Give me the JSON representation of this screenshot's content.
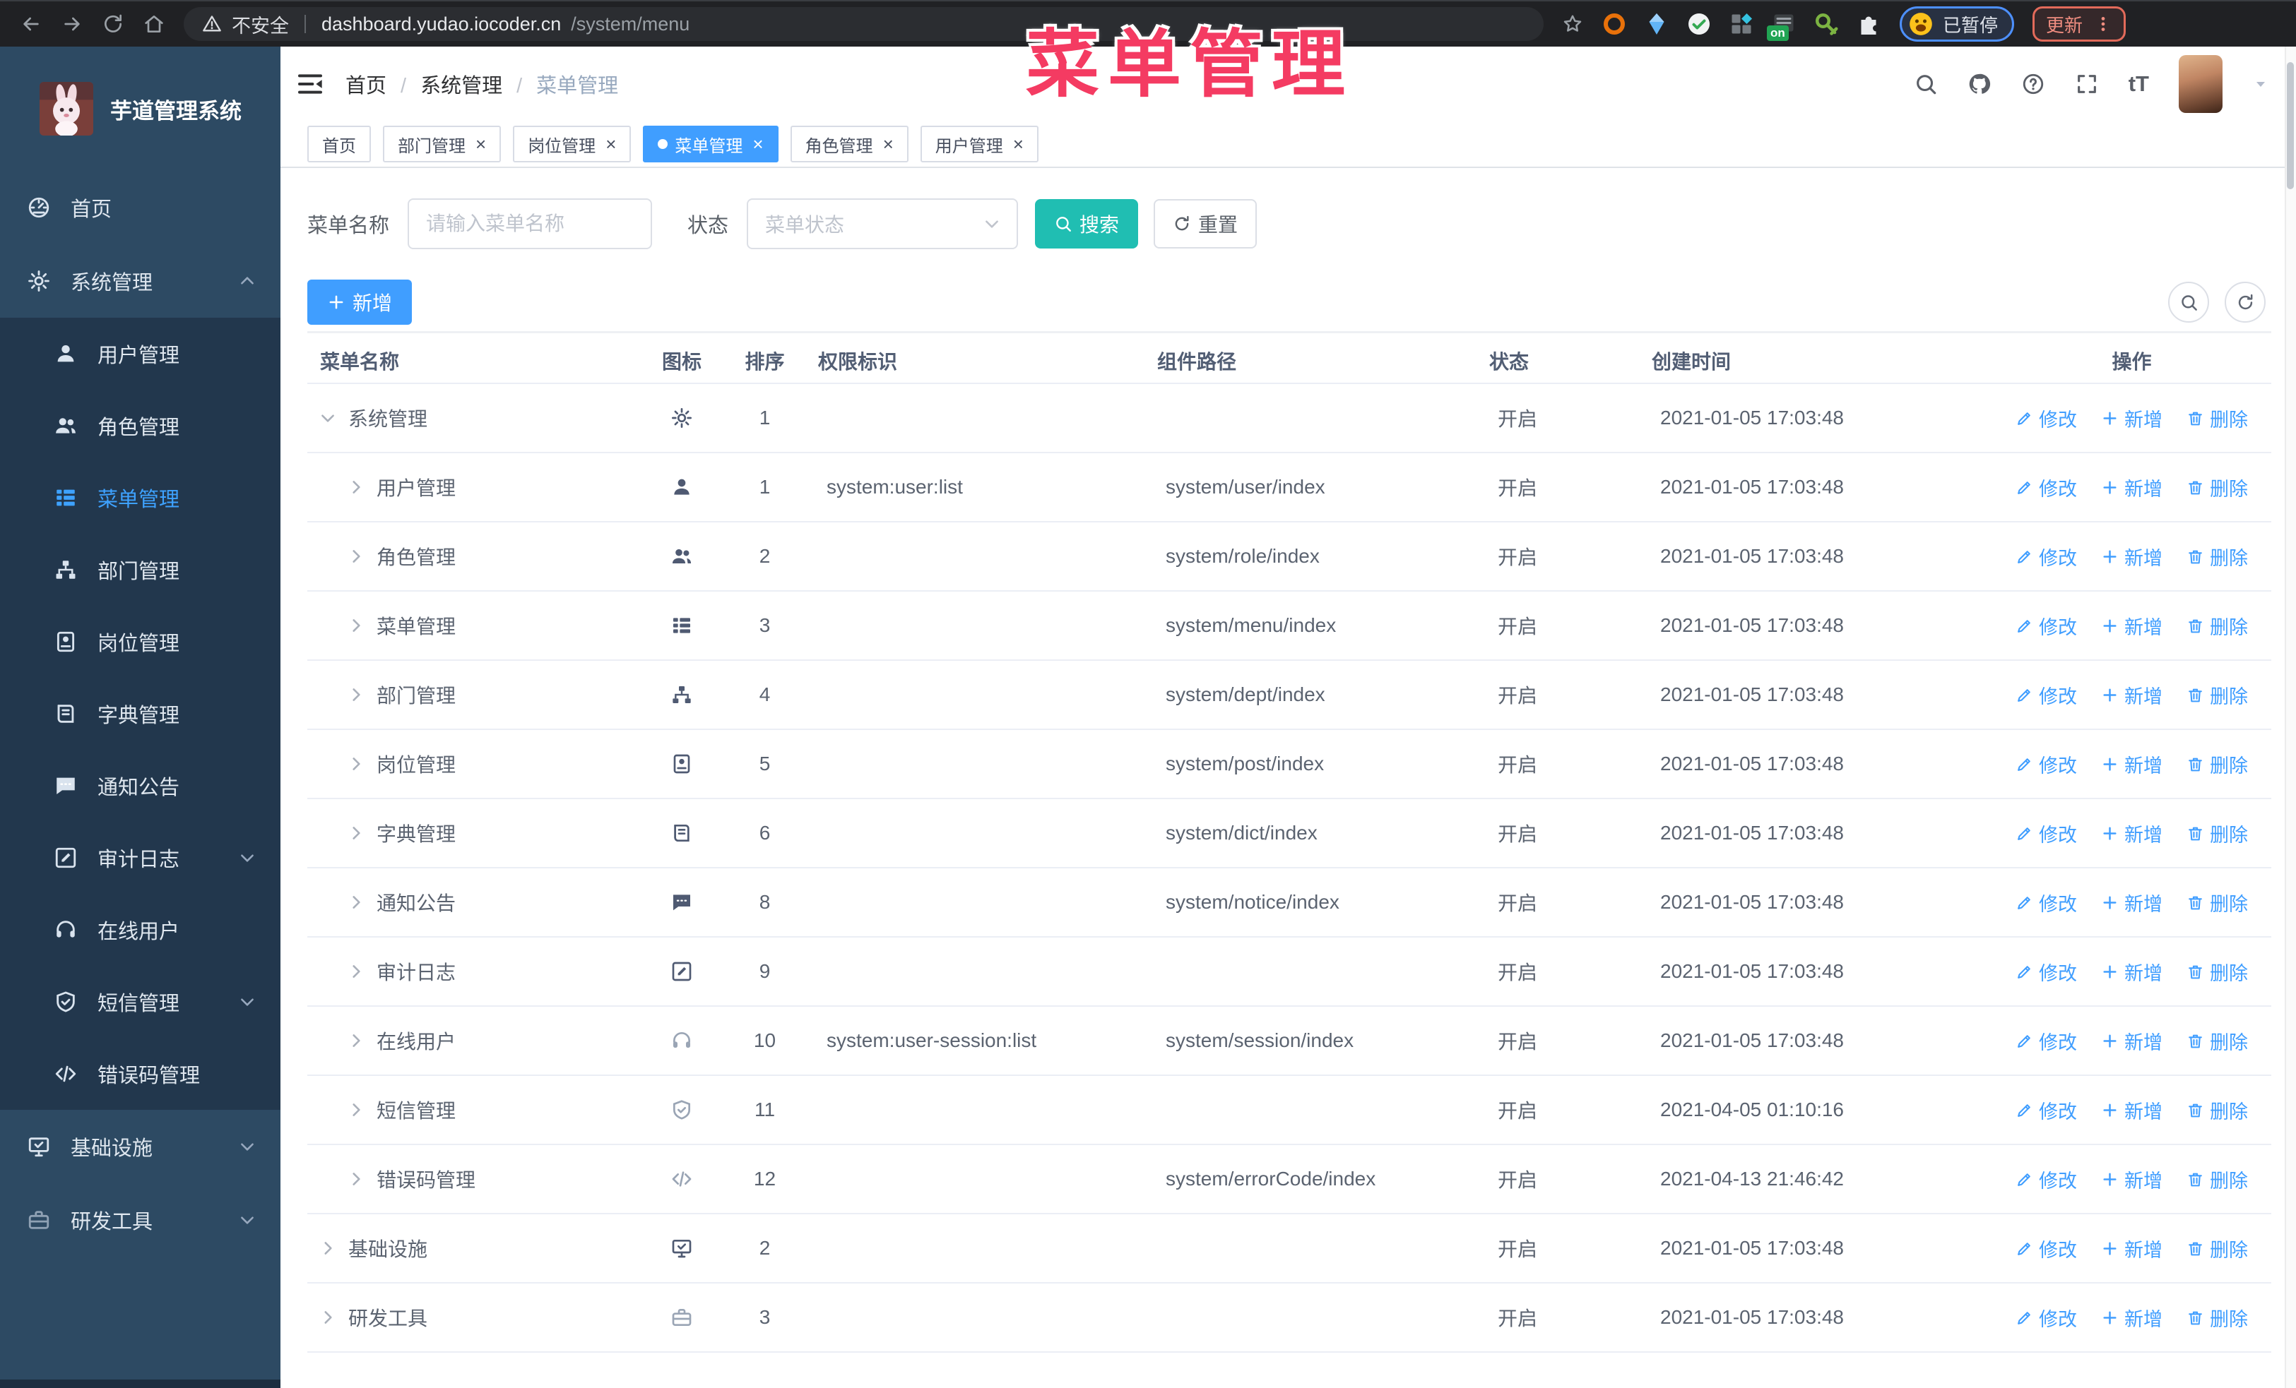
{
  "overlay": {
    "title": "菜单管理"
  },
  "browser": {
    "security_label": "不安全",
    "url_host": "dashboard.yudao.iocoder.cn",
    "url_path": "/system/menu",
    "extension_on_badge": "on",
    "paused_chip": "已暂停",
    "update_chip": "更新"
  },
  "appbar": {
    "breadcrumb": [
      "首页",
      "系统管理",
      "菜单管理"
    ],
    "breadcrumb_sep": "/",
    "font_size_glyph": "tT"
  },
  "tabs_meta": {
    "close_glyph": "×"
  },
  "tabs": [
    {
      "label": "首页",
      "closable": false,
      "active": false
    },
    {
      "label": "部门管理",
      "closable": true,
      "active": false
    },
    {
      "label": "岗位管理",
      "closable": true,
      "active": false
    },
    {
      "label": "菜单管理",
      "closable": true,
      "active": true
    },
    {
      "label": "角色管理",
      "closable": true,
      "active": false
    },
    {
      "label": "用户管理",
      "closable": true,
      "active": false
    }
  ],
  "sidebar": {
    "logo_title": "芋道管理系统",
    "items": [
      {
        "label": "首页",
        "icon": "dashboard-icon",
        "sub": false
      },
      {
        "label": "系统管理",
        "icon": "gear-icon",
        "sub": false,
        "chevron": "chevron-up-icon"
      },
      {
        "label": "用户管理",
        "icon": "user-icon",
        "sub": true
      },
      {
        "label": "角色管理",
        "icon": "users-icon",
        "sub": true
      },
      {
        "label": "菜单管理",
        "icon": "menu-tree-icon",
        "sub": true,
        "active": true
      },
      {
        "label": "部门管理",
        "icon": "org-tree-icon",
        "sub": true
      },
      {
        "label": "岗位管理",
        "icon": "badge-icon",
        "sub": true
      },
      {
        "label": "字典管理",
        "icon": "book-icon",
        "sub": true
      },
      {
        "label": "通知公告",
        "icon": "chat-icon",
        "sub": true
      },
      {
        "label": "审计日志",
        "icon": "edit-square-icon",
        "sub": true,
        "chevron": "chevron-down-icon"
      },
      {
        "label": "在线用户",
        "icon": "headset-icon",
        "sub": true
      },
      {
        "label": "短信管理",
        "icon": "shield-icon",
        "sub": true,
        "chevron": "chevron-down-icon"
      },
      {
        "label": "错误码管理",
        "icon": "code-icon",
        "sub": true
      },
      {
        "label": "基础设施",
        "icon": "monitor-icon",
        "sub": false,
        "chevron": "chevron-down-icon"
      },
      {
        "label": "研发工具",
        "icon": "toolbox-icon",
        "sub": false,
        "chevron": "chevron-down-icon",
        "muted": true
      }
    ]
  },
  "filters": {
    "name_label": "菜单名称",
    "name_placeholder": "请输入菜单名称",
    "status_label": "状态",
    "status_placeholder": "菜单状态",
    "search_label": "搜索",
    "reset_label": "重置"
  },
  "toolbar": {
    "add_label": "新增"
  },
  "table": {
    "columns": [
      "菜单名称",
      "图标",
      "排序",
      "权限标识",
      "组件路径",
      "状态",
      "创建时间",
      "操作"
    ],
    "ops": {
      "edit": "修改",
      "add": "新增",
      "delete": "删除"
    },
    "rows": [
      {
        "name": "系统管理",
        "icon": "gear-icon",
        "caret": "chevron-down-icon",
        "child": false,
        "sort": "1",
        "perm": "",
        "path": "",
        "status": "开启",
        "time": "2021-01-05 17:03:48"
      },
      {
        "name": "用户管理",
        "icon": "user-icon",
        "caret": "chevron-right-icon",
        "child": true,
        "sort": "1",
        "perm": "system:user:list",
        "path": "system/user/index",
        "status": "开启",
        "time": "2021-01-05 17:03:48"
      },
      {
        "name": "角色管理",
        "icon": "users-icon",
        "caret": "chevron-right-icon",
        "child": true,
        "sort": "2",
        "perm": "",
        "path": "system/role/index",
        "status": "开启",
        "time": "2021-01-05 17:03:48"
      },
      {
        "name": "菜单管理",
        "icon": "menu-tree-icon",
        "caret": "chevron-right-icon",
        "child": true,
        "sort": "3",
        "perm": "",
        "path": "system/menu/index",
        "status": "开启",
        "time": "2021-01-05 17:03:48"
      },
      {
        "name": "部门管理",
        "icon": "org-tree-icon",
        "caret": "chevron-right-icon",
        "child": true,
        "sort": "4",
        "perm": "",
        "path": "system/dept/index",
        "status": "开启",
        "time": "2021-01-05 17:03:48"
      },
      {
        "name": "岗位管理",
        "icon": "badge-icon",
        "caret": "chevron-right-icon",
        "child": true,
        "sort": "5",
        "perm": "",
        "path": "system/post/index",
        "status": "开启",
        "time": "2021-01-05 17:03:48"
      },
      {
        "name": "字典管理",
        "icon": "book-icon",
        "caret": "chevron-right-icon",
        "child": true,
        "sort": "6",
        "perm": "",
        "path": "system/dict/index",
        "status": "开启",
        "time": "2021-01-05 17:03:48"
      },
      {
        "name": "通知公告",
        "icon": "chat-icon",
        "caret": "chevron-right-icon",
        "child": true,
        "sort": "8",
        "perm": "",
        "path": "system/notice/index",
        "status": "开启",
        "time": "2021-01-05 17:03:48"
      },
      {
        "name": "审计日志",
        "icon": "edit-square-icon",
        "caret": "chevron-right-icon",
        "child": true,
        "sort": "9",
        "perm": "",
        "path": "",
        "status": "开启",
        "time": "2021-01-05 17:03:48"
      },
      {
        "name": "在线用户",
        "icon": "headset-icon",
        "muted": true,
        "caret": "chevron-right-icon",
        "child": true,
        "sort": "10",
        "perm": "system:user-session:list",
        "path": "system/session/index",
        "status": "开启",
        "time": "2021-01-05 17:03:48"
      },
      {
        "name": "短信管理",
        "icon": "shield-icon",
        "muted": true,
        "caret": "chevron-right-icon",
        "child": true,
        "sort": "11",
        "perm": "",
        "path": "",
        "status": "开启",
        "time": "2021-04-05 01:10:16"
      },
      {
        "name": "错误码管理",
        "icon": "code-icon",
        "muted": true,
        "caret": "chevron-right-icon",
        "child": true,
        "sort": "12",
        "perm": "",
        "path": "system/errorCode/index",
        "status": "开启",
        "time": "2021-04-13 21:46:42"
      },
      {
        "name": "基础设施",
        "icon": "monitor-icon",
        "caret": "chevron-right-icon",
        "child": false,
        "sort": "2",
        "perm": "",
        "path": "",
        "status": "开启",
        "time": "2021-01-05 17:03:48"
      },
      {
        "name": "研发工具",
        "icon": "toolbox-icon",
        "muted": true,
        "caret": "chevron-right-icon",
        "child": false,
        "sort": "3",
        "perm": "",
        "path": "",
        "status": "开启",
        "time": "2021-01-05 17:03:48"
      }
    ]
  },
  "colors": {
    "accent_blue": "#409eff",
    "search_teal": "#20beb2",
    "overlay_pink": "#f43b62",
    "sidebar_bg": "#2d4a63",
    "sidebar_sub_bg": "#22374d"
  }
}
